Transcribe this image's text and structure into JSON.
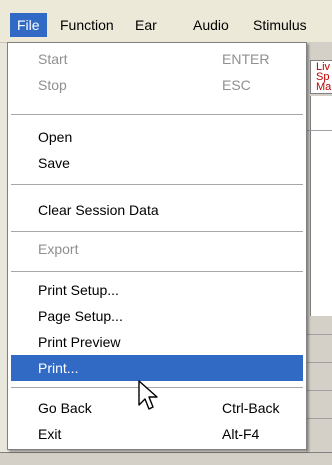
{
  "menubar": {
    "items": [
      {
        "label": "File"
      },
      {
        "label": "Function"
      },
      {
        "label": "Ear"
      },
      {
        "label": "Audio"
      },
      {
        "label": "Stimulus"
      }
    ]
  },
  "background": {
    "panel_text": [
      "Liv",
      "Sp",
      "Ma"
    ]
  },
  "file_menu": {
    "items": [
      {
        "label": "Start",
        "shortcut": "ENTER",
        "enabled": false
      },
      {
        "label": "Stop",
        "shortcut": "ESC",
        "enabled": false
      },
      {
        "label": "Open",
        "shortcut": "",
        "enabled": true
      },
      {
        "label": "Save",
        "shortcut": "",
        "enabled": true
      },
      {
        "label": "Clear Session Data",
        "shortcut": "",
        "enabled": true
      },
      {
        "label": "Export",
        "shortcut": "",
        "enabled": false
      },
      {
        "label": "Print Setup...",
        "shortcut": "",
        "enabled": true
      },
      {
        "label": "Page Setup...",
        "shortcut": "",
        "enabled": true
      },
      {
        "label": "Print Preview",
        "shortcut": "",
        "enabled": true
      },
      {
        "label": "Print...",
        "shortcut": "",
        "enabled": true,
        "highlighted": true
      },
      {
        "label": "Go Back",
        "shortcut": "Ctrl-Back",
        "enabled": true
      },
      {
        "label": "Exit",
        "shortcut": "Alt-F4",
        "enabled": true
      }
    ]
  },
  "colors": {
    "highlight": "#316ac5",
    "disabled_text": "#8f8f8f"
  },
  "cursor": {
    "icon": "arrow-cursor-icon"
  }
}
